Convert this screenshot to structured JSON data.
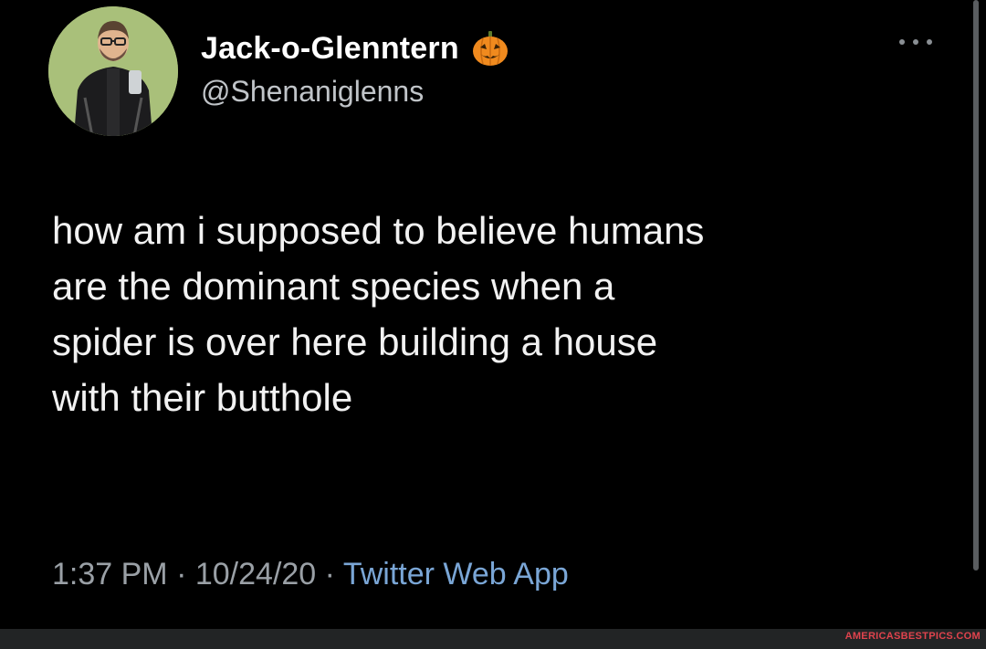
{
  "author": {
    "display_name": "Jack-o-Glenntern",
    "handle": "@Shenaniglenns",
    "name_badge_icon": "jack-o-lantern-icon"
  },
  "tweet": {
    "text": "how am i supposed to believe humans\nare the dominant species when a\nspider is over here building a house\nwith their butthole"
  },
  "meta": {
    "time": "1:37 PM",
    "separator": "·",
    "date": "10/24/20",
    "source": "Twitter Web App"
  },
  "menu_icon": "more-horizontal-icon",
  "watermark": "AMERICASBESTPICS.COM",
  "colors": {
    "background": "#000000",
    "text": "#f2f2f2",
    "secondary_text": "#9aa0a6",
    "link": "#7aa6d6",
    "pumpkin": "#f08a1e"
  }
}
